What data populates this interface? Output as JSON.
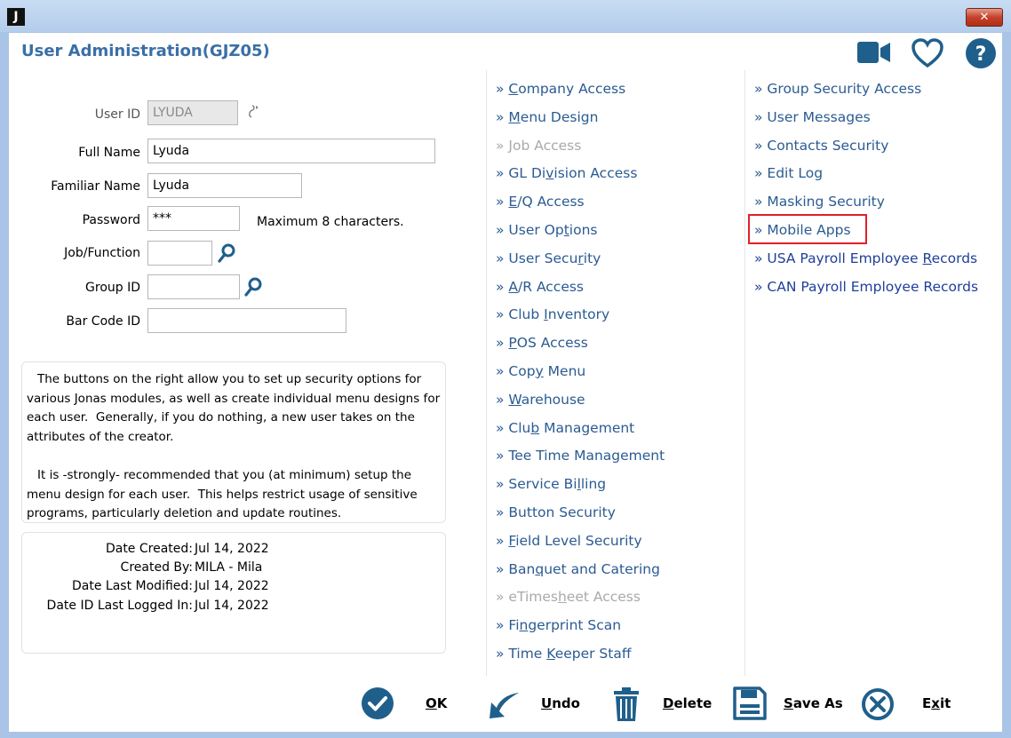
{
  "window": {
    "app_icon_letter": "J",
    "close_glyph": "✕"
  },
  "header": {
    "title": "User Administration(GJZ05)"
  },
  "form": {
    "user_id": {
      "label": "User ID",
      "value": "LYUDA"
    },
    "full_name": {
      "label": "Full Name",
      "value": "Lyuda"
    },
    "familiar_name": {
      "label": "Familiar Name",
      "value": "Lyuda"
    },
    "password": {
      "label": "Password",
      "value": "***",
      "hint": "Maximum 8 characters."
    },
    "job_function": {
      "label": "Job/Function",
      "value": ""
    },
    "group_id": {
      "label": "Group ID",
      "value": ""
    },
    "bar_code_id": {
      "label": "Bar Code ID",
      "value": ""
    }
  },
  "info": {
    "para1": "The buttons on the right allow you to set up security options for various Jonas modules, as well as create individual menu designs for each user.  Generally, if you do nothing, a new user takes on the attributes of the creator.",
    "para2": "It is -strongly- recommended that you (at minimum) setup the menu design for each user.  This helps restrict usage of sensitive programs, particularly deletion and update routines."
  },
  "meta": [
    {
      "label": "Date Created:",
      "value": "Jul 14, 2022"
    },
    {
      "label": "Created By:",
      "value": "MILA - Mila"
    },
    {
      "label": "Date Last Modified:",
      "value": "Jul 14, 2022"
    },
    {
      "label": "Date ID Last Logged In:",
      "value": "Jul 14, 2022"
    }
  ],
  "links_col1": [
    {
      "pre": "» ",
      "key": "C",
      "post": "ompany Access",
      "disabled": false
    },
    {
      "pre": "» ",
      "key": "M",
      "post": "enu Design",
      "disabled": false
    },
    {
      "pre": "» ",
      "key": "J",
      "post": "ob Access",
      "disabled": true
    },
    {
      "pre": "» GL Di",
      "key": "v",
      "post": "ision Access",
      "disabled": false
    },
    {
      "pre": "» ",
      "key": "E",
      "post": "/Q Access",
      "disabled": false
    },
    {
      "pre": "» User Op",
      "key": "t",
      "post": "ions",
      "disabled": false
    },
    {
      "pre": "» User Secu",
      "key": "r",
      "post": "ity",
      "disabled": false
    },
    {
      "pre": "» ",
      "key": "A",
      "post": "/R Access",
      "disabled": false
    },
    {
      "pre": "» Club ",
      "key": "I",
      "post": "nventory",
      "disabled": false
    },
    {
      "pre": "» ",
      "key": "P",
      "post": "OS Access",
      "disabled": false
    },
    {
      "pre": "» Cop",
      "key": "y",
      "post": " Menu",
      "disabled": false
    },
    {
      "pre": "» ",
      "key": "W",
      "post": "arehouse",
      "disabled": false
    },
    {
      "pre": "» Clu",
      "key": "b",
      "post": " Management",
      "disabled": false
    },
    {
      "pre": "» Tee Time Management",
      "key": "",
      "post": "",
      "disabled": false
    },
    {
      "pre": "» Service Bi",
      "key": "l",
      "post": "ling",
      "disabled": false
    },
    {
      "pre": "» Button Security",
      "key": "",
      "post": "",
      "disabled": false
    },
    {
      "pre": "» ",
      "key": "F",
      "post": "ield Level Security",
      "disabled": false
    },
    {
      "pre": "» Ban",
      "key": "q",
      "post": "uet and Catering",
      "disabled": false
    },
    {
      "pre": "» eTimes",
      "key": "h",
      "post": "eet Access",
      "disabled": true
    },
    {
      "pre": "» Fi",
      "key": "n",
      "post": "gerprint Scan",
      "disabled": false
    },
    {
      "pre": "» Time ",
      "key": "K",
      "post": "eeper Staff",
      "disabled": false
    }
  ],
  "links_col2": [
    {
      "pre": "» Group Security Access",
      "key": "",
      "post": "",
      "style": "normal"
    },
    {
      "pre": "» User Messages",
      "key": "",
      "post": "",
      "style": "normal"
    },
    {
      "pre": "» Contacts Security",
      "key": "",
      "post": "",
      "style": "normal"
    },
    {
      "pre": "» Edit Log",
      "key": "",
      "post": "",
      "style": "normal"
    },
    {
      "pre": "» Masking Security",
      "key": "",
      "post": "",
      "style": "normal"
    },
    {
      "pre": "» Mobile Apps",
      "key": "",
      "post": "",
      "style": "highlight"
    },
    {
      "pre": "» USA Payroll Employee ",
      "key": "R",
      "post": "ecords",
      "style": "navy"
    },
    {
      "pre": "» CAN Payroll Employee Records",
      "key": "",
      "post": "",
      "style": "navy"
    }
  ],
  "buttons": {
    "ok": {
      "pre": "",
      "key": "O",
      "post": "K"
    },
    "undo": {
      "pre": "",
      "key": "U",
      "post": "ndo"
    },
    "delete": {
      "pre": "",
      "key": "D",
      "post": "elete"
    },
    "save_as": {
      "pre": "",
      "key": "S",
      "post": "ave As"
    },
    "exit": {
      "pre": "E",
      "key": "x",
      "post": "it"
    }
  },
  "colors": {
    "accent": "#1f5f8b",
    "title": "#3a6fa6",
    "link": "#2b5b92",
    "highlight_border": "#e0202a"
  }
}
